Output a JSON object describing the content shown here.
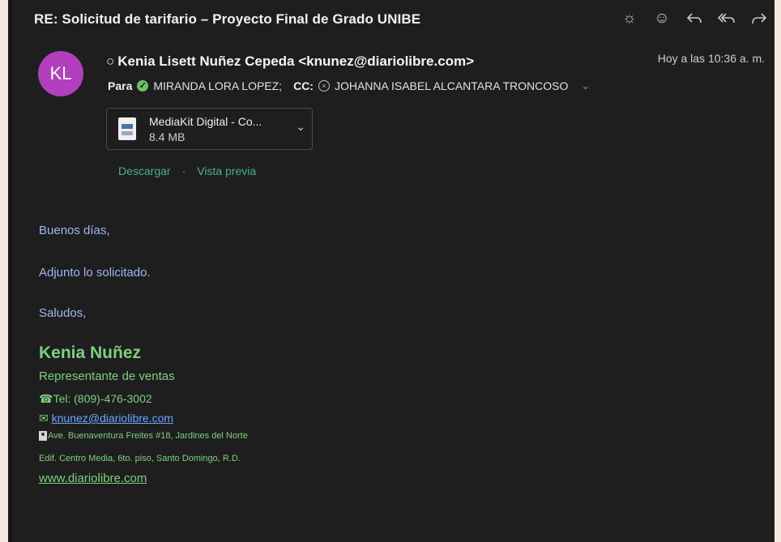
{
  "email": {
    "subject": "RE: Solicitud de tarifario – Proyecto Final de Grado UNIBE",
    "avatar_initials": "KL",
    "sender": "Kenia Lisett Nuñez Cepeda <knunez@diariolibre.com>",
    "timestamp": "Hoy a las 10:36 a. m.",
    "to_label": "Para",
    "to": "MIRANDA LORA LOPEZ;",
    "cc_label": "CC:",
    "cc": "JOHANNA ISABEL ALCANTARA TRONCOSO"
  },
  "toolbar": {
    "icons": [
      "sun-icon",
      "emoji-icon",
      "reply-icon",
      "reply-all-icon",
      "forward-icon"
    ]
  },
  "attachment": {
    "name": "MediaKit Digital - Co...",
    "size": "8.4 MB",
    "download": "Descargar",
    "separator": "·",
    "preview": "Vista previa"
  },
  "body": {
    "greeting": "Buenos días,",
    "line1": "Adjunto lo solicitado.",
    "closing": "Saludos,"
  },
  "signature": {
    "name": "Kenia Nuñez",
    "role": "Representante de ventas",
    "tel_label": "Tel: ",
    "tel": "(809)-476-3002",
    "email": "knunez@diariolibre.com",
    "address1": "Ave. Buenaventura Freites #18, Jardines del Norte",
    "address2": "Edif. Centro Media, 6to. piso, Santo Domingo, R.D.",
    "website": "www.diariolibre.com"
  },
  "colors": {
    "background": "#1e1e1f",
    "accent_green": "#47b38c",
    "signature_green": "#7ed07d",
    "body_blue": "#9fb7f0",
    "avatar": "#b23fbd"
  }
}
